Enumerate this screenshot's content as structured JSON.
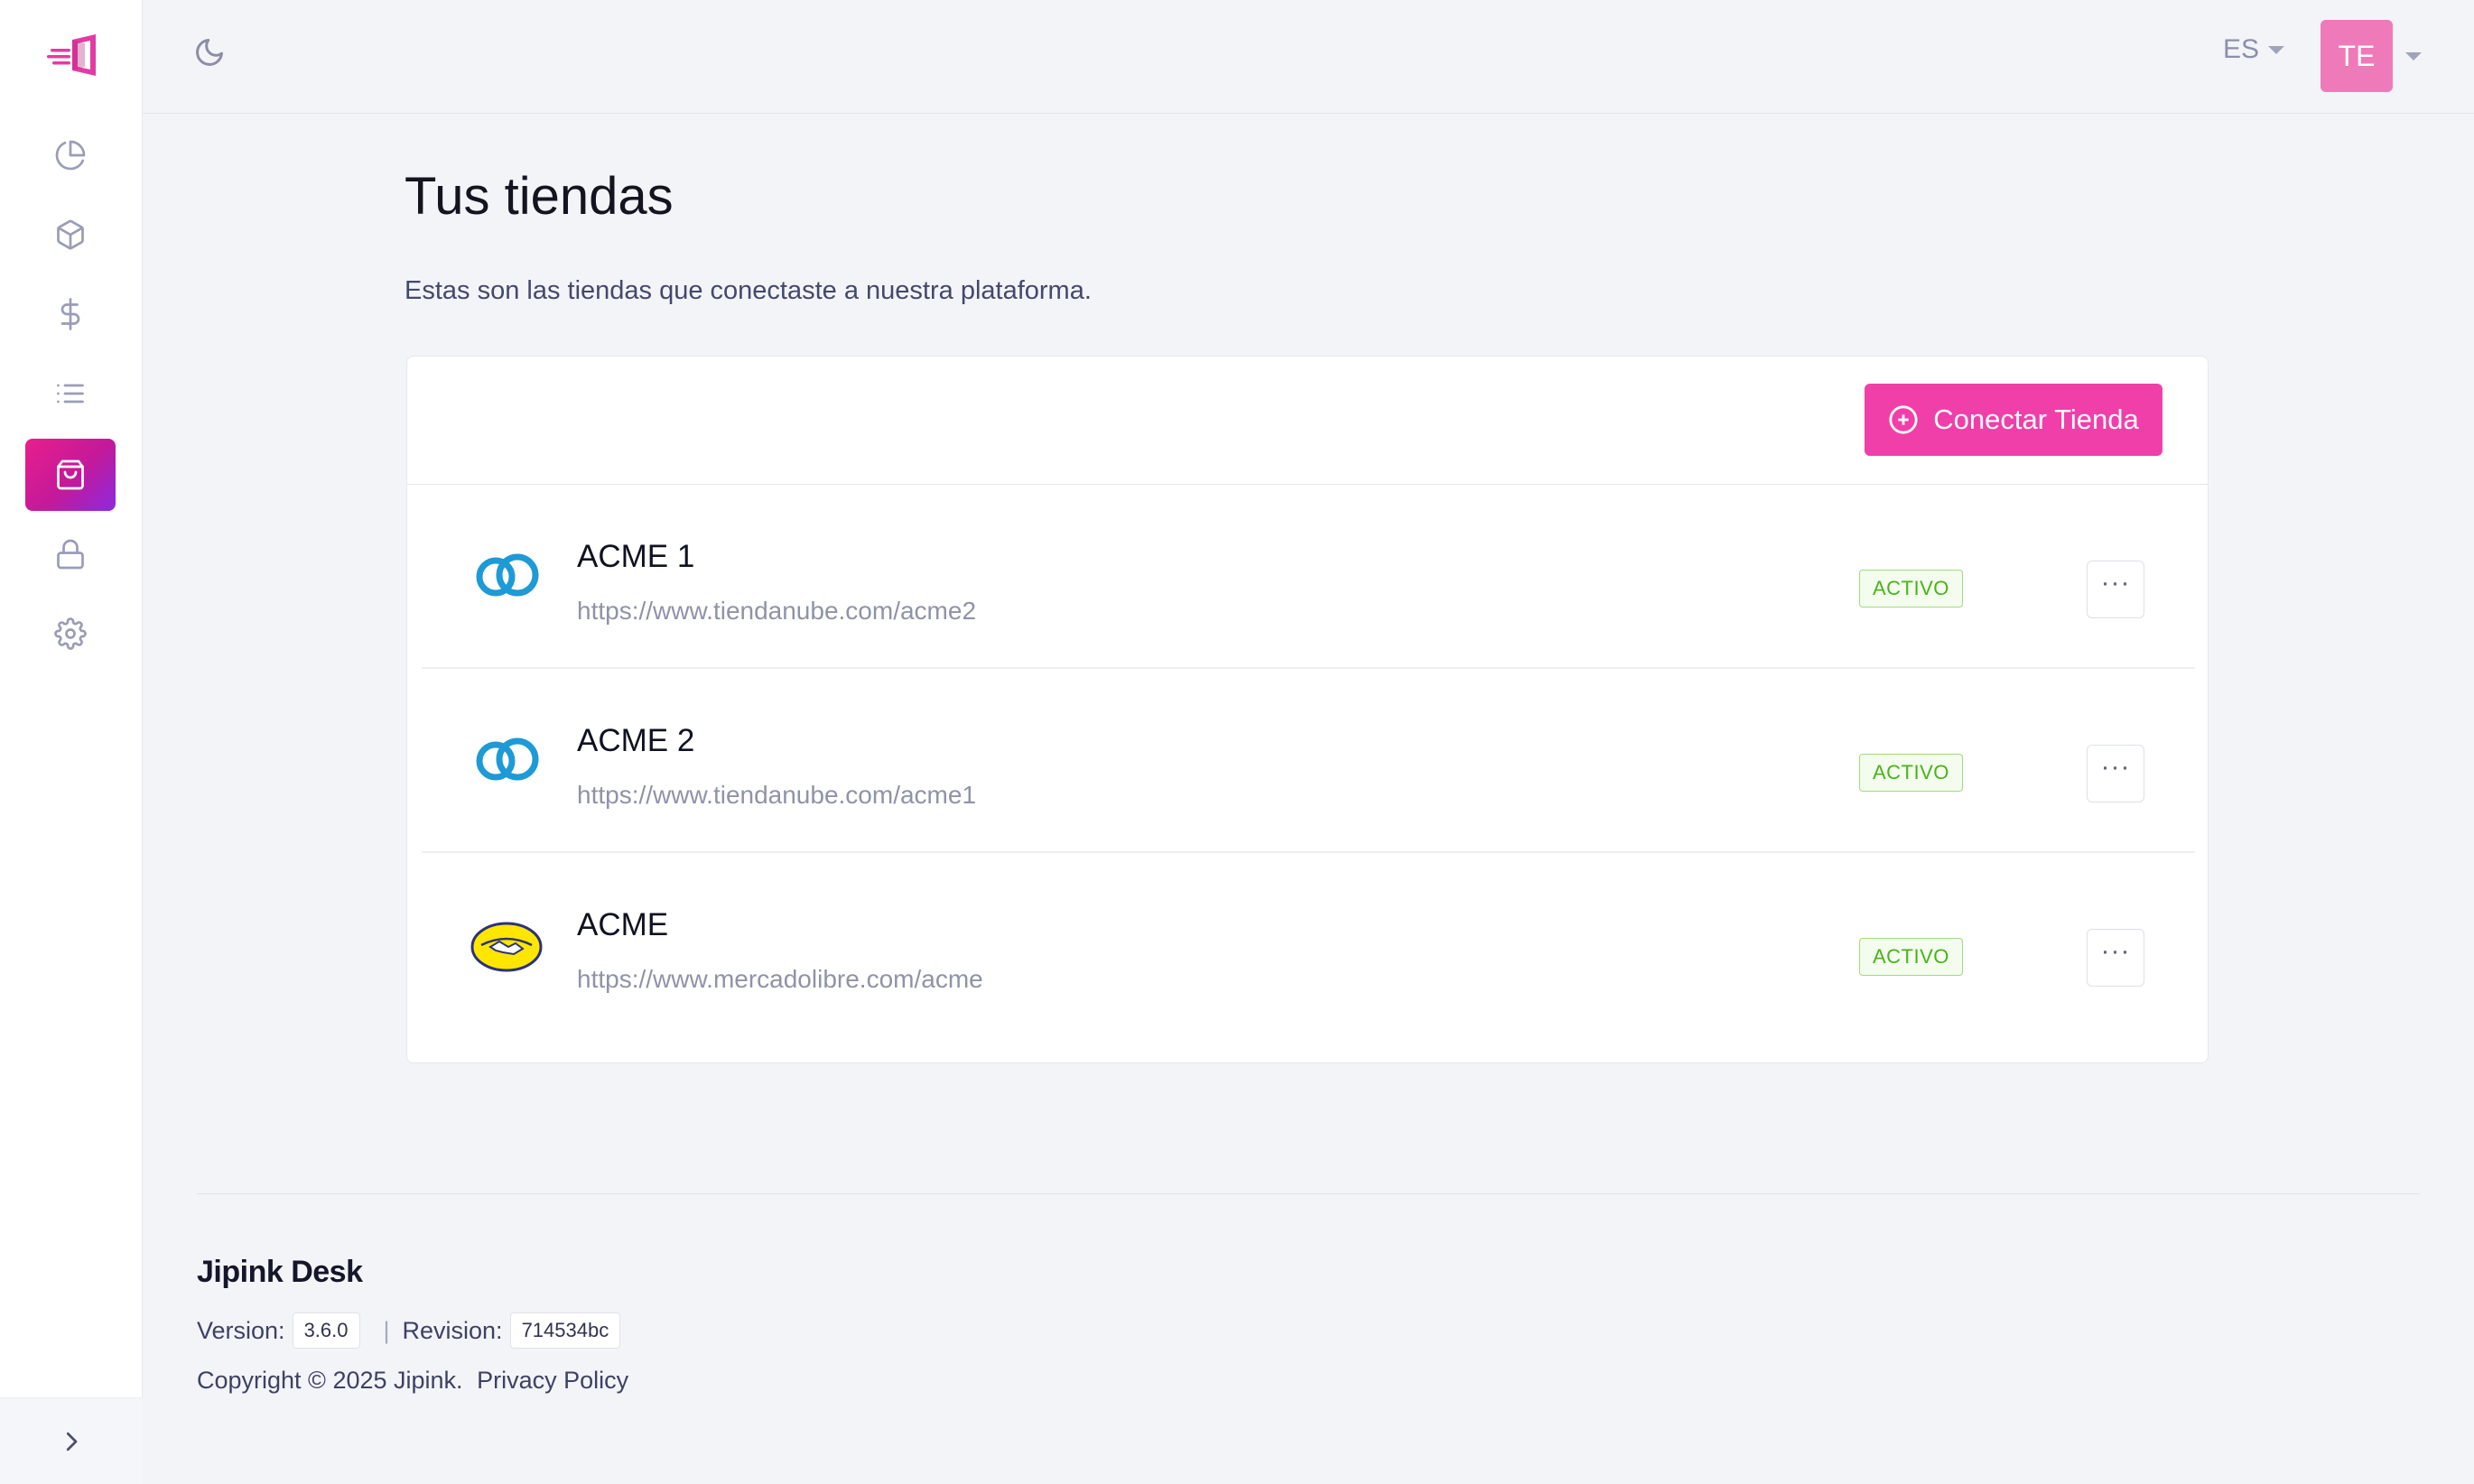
{
  "header": {
    "language": "ES",
    "user_initials": "TE"
  },
  "sidebar": {
    "items": [
      {
        "icon": "pie-chart-icon"
      },
      {
        "icon": "box-icon"
      },
      {
        "icon": "dollar-icon"
      },
      {
        "icon": "list-icon"
      },
      {
        "icon": "shopping-bag-icon",
        "active": true
      },
      {
        "icon": "lock-icon"
      },
      {
        "icon": "gear-icon"
      }
    ],
    "expand_icon": "chevron-right-icon"
  },
  "main": {
    "title": "Tus tiendas",
    "subtitle": "Estas son las tiendas que conectaste a nuestra plataforma.",
    "connect_button": "Conectar Tienda",
    "stores": [
      {
        "name": "ACME 1",
        "url": "https://www.tiendanube.com/acme2",
        "status": "ACTIVO",
        "platform": "tiendanube-logo"
      },
      {
        "name": "ACME 2",
        "url": "https://www.tiendanube.com/acme1",
        "status": "ACTIVO",
        "platform": "tiendanube-logo"
      },
      {
        "name": "ACME",
        "url": "https://www.mercadolibre.com/acme",
        "status": "ACTIVO",
        "platform": "mercadolibre-logo"
      }
    ],
    "more_label": "···"
  },
  "footer": {
    "brand": "Jipink Desk",
    "version_label": "Version:",
    "version": "3.6.0",
    "separator": "|",
    "revision_label": "Revision:",
    "revision": "714534bc",
    "copyright": "Copyright © 2025 Jipink.",
    "privacy_policy": "Privacy Policy"
  },
  "colors": {
    "accent": "#f03fa9",
    "active_nav": "#d31d91",
    "status_active": "#49b31a"
  }
}
